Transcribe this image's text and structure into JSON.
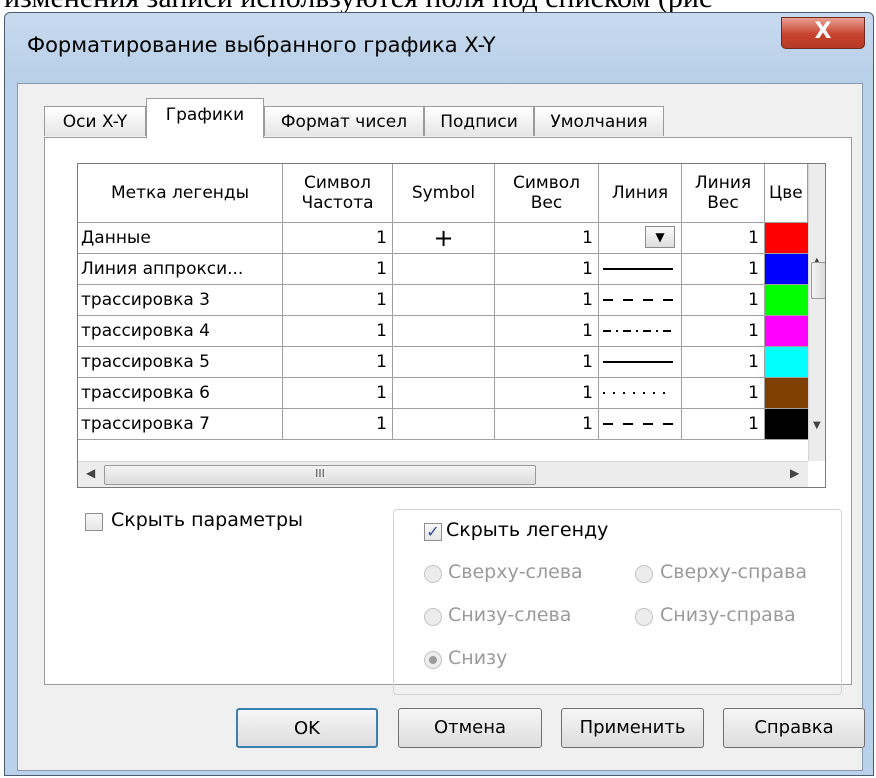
{
  "background_text": "изменения записи используются поля под списком (рис",
  "dialog": {
    "title": "Форматирование выбранного графика X-Y",
    "close_label": "X"
  },
  "tabs": [
    "Оси X-Y",
    "Графики",
    "Формат чисел",
    "Подписи",
    "Умолчания"
  ],
  "active_tab": "Графики",
  "grid": {
    "columns": [
      "Метка легенды",
      "Символ\nЧастота",
      "Symbol",
      "Символ\nВес",
      "Линия",
      "Линия\nВес",
      "Цве"
    ],
    "rows": [
      {
        "label": "Данные",
        "sym_freq": "1",
        "symbol": "+",
        "sym_weight": "1",
        "line": "dropdown",
        "line_weight": "1",
        "color": "#ff0000"
      },
      {
        "label": "Линия аппрокси...",
        "sym_freq": "1",
        "symbol": "",
        "sym_weight": "1",
        "line": "solid",
        "line_weight": "1",
        "color": "#0000ff"
      },
      {
        "label": "трассировка 3",
        "sym_freq": "1",
        "symbol": "",
        "sym_weight": "1",
        "line": "dash",
        "line_weight": "1",
        "color": "#00ff00"
      },
      {
        "label": "трассировка 4",
        "sym_freq": "1",
        "symbol": "",
        "sym_weight": "1",
        "line": "dashdot",
        "line_weight": "1",
        "color": "#ff00ff"
      },
      {
        "label": "трассировка 5",
        "sym_freq": "1",
        "symbol": "",
        "sym_weight": "1",
        "line": "solid",
        "line_weight": "1",
        "color": "#00ffff"
      },
      {
        "label": "трассировка 6",
        "sym_freq": "1",
        "symbol": "",
        "sym_weight": "1",
        "line": "dot",
        "line_weight": "1",
        "color": "#7f3f00"
      },
      {
        "label": "трассировка 7",
        "sym_freq": "1",
        "symbol": "",
        "sym_weight": "1",
        "line": "dash",
        "line_weight": "1",
        "color": "#000000"
      }
    ],
    "hscroll_grip": "III"
  },
  "options": {
    "hide_params": {
      "label": "Скрыть параметры",
      "checked": false
    },
    "hide_legend": {
      "label": "Скрыть легенду",
      "checked": true
    },
    "positions": [
      {
        "label": "Сверху-слева",
        "selected": false
      },
      {
        "label": "Сверху-справа",
        "selected": false
      },
      {
        "label": "Снизу-слева",
        "selected": false
      },
      {
        "label": "Снизу-справа",
        "selected": false
      },
      {
        "label": "Снизу",
        "selected": true
      }
    ]
  },
  "buttons": {
    "ok": "OK",
    "cancel": "Отмена",
    "apply": "Применить",
    "help": "Справка"
  }
}
